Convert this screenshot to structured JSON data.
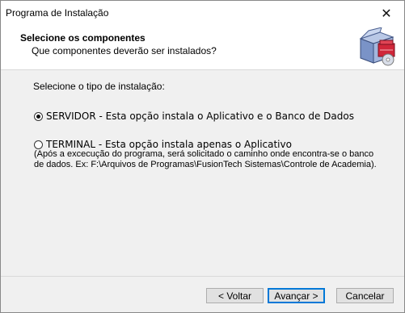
{
  "window": {
    "title": "Programa de Instalação"
  },
  "header": {
    "title": "Selecione os componentes",
    "subtitle": "Que componentes deverão ser instalados?"
  },
  "content": {
    "section_label": "Selecione o tipo de instalação:",
    "options": [
      {
        "label": "SERVIDOR - Esta opção instala o Aplicativo e o Banco de Dados",
        "selected": true
      },
      {
        "label": "TERMINAL - Esta opção instala apenas o Aplicativo",
        "selected": false
      }
    ],
    "note_line1": "(Após a excecução do programa, será solicitado o caminho onde encontra-se o banco",
    "note_line2": "de dados. Ex: F:\\Arquivos de Programas\\FusionTech Sistemas\\Controle de Academia)."
  },
  "buttons": {
    "back_label": "< Voltar",
    "next_label": "Avançar >",
    "cancel_label": "Cancelar"
  },
  "icons": {
    "close": "close-icon",
    "header": "installer-box-icon"
  }
}
